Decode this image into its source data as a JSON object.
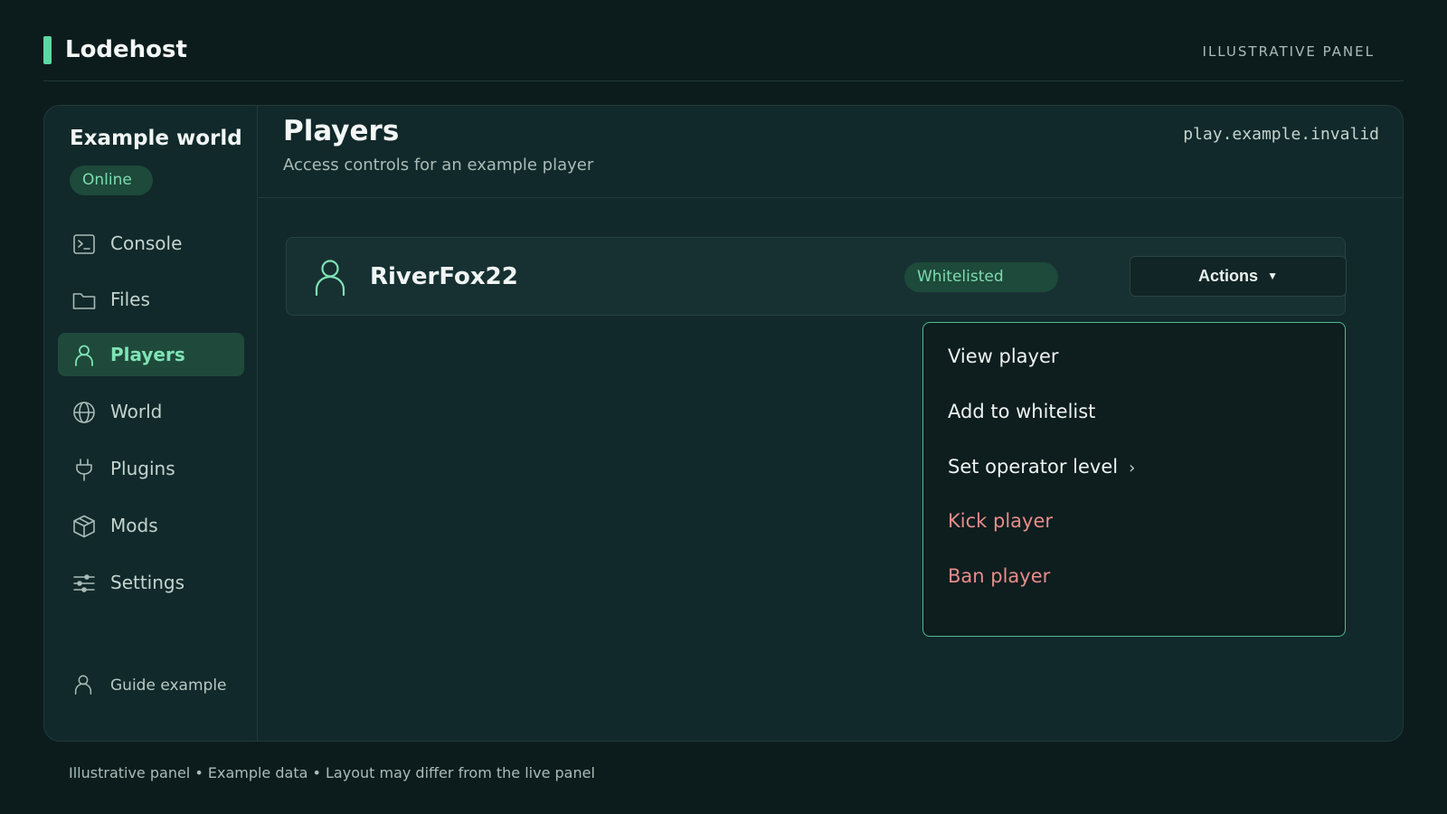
{
  "app": {
    "brand": "Lodehost",
    "tag": "ILLUSTRATIVE PANEL"
  },
  "sidebar": {
    "world_name": "Example world",
    "status": "Online",
    "items": [
      {
        "label": "Console",
        "icon": "console-icon"
      },
      {
        "label": "Files",
        "icon": "folder-icon"
      },
      {
        "label": "Players",
        "icon": "user-icon",
        "active": true
      },
      {
        "label": "World",
        "icon": "globe-icon"
      },
      {
        "label": "Plugins",
        "icon": "plug-icon"
      },
      {
        "label": "Mods",
        "icon": "box-icon"
      },
      {
        "label": "Settings",
        "icon": "sliders-icon"
      }
    ],
    "user": {
      "label": "Guide example",
      "icon": "user-icon"
    }
  },
  "main": {
    "title": "Players",
    "subtitle": "Access controls for an example player",
    "address": "play.example.invalid",
    "player": {
      "name": "RiverFox22",
      "status": "Whitelisted",
      "actions_label": "Actions",
      "actions_caret": "▼"
    },
    "menu": [
      {
        "label": "View player",
        "danger": false
      },
      {
        "label": "Add to whitelist",
        "danger": false
      },
      {
        "label": "Set operator level",
        "danger": false,
        "submenu_glyph": "›"
      },
      {
        "label": "Kick player",
        "danger": true
      },
      {
        "label": "Ban player",
        "danger": true
      }
    ]
  },
  "footer": {
    "note": "Illustrative panel • Example data • Layout may differ from the live panel"
  },
  "colors": {
    "background": "#0c1c1c",
    "panel": "#11292a",
    "accent": "#5fd6a4",
    "badge_bg": "#1d4a3a",
    "danger": "#e58d8b"
  }
}
